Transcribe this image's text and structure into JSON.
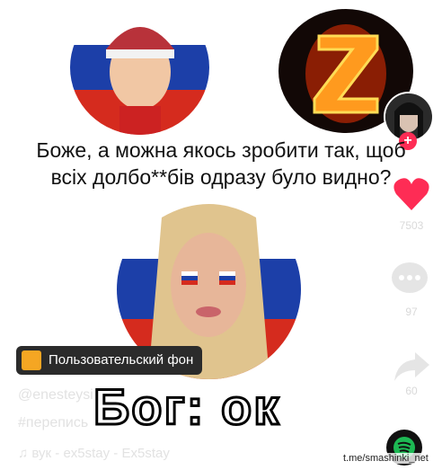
{
  "caption": {
    "line1": "Боже, а можна якось зробити так, щоб",
    "line2": "всіх долбо**бів одразу було видно?"
  },
  "actions": {
    "likes": "7503",
    "comments": "97",
    "shares": "60"
  },
  "background_chip": {
    "label": "Пользовательский фон"
  },
  "post": {
    "username": "@enesteysi",
    "hashtag": "#перепись",
    "music": "♫  вук - ex5stay - Ex5stay"
  },
  "overlay": {
    "big_text": "Бог: ок"
  },
  "watermark": "t.me/smashinki_net",
  "colors": {
    "accent_like": "#fe2c55",
    "chip_bg": "#2b2b2b"
  }
}
